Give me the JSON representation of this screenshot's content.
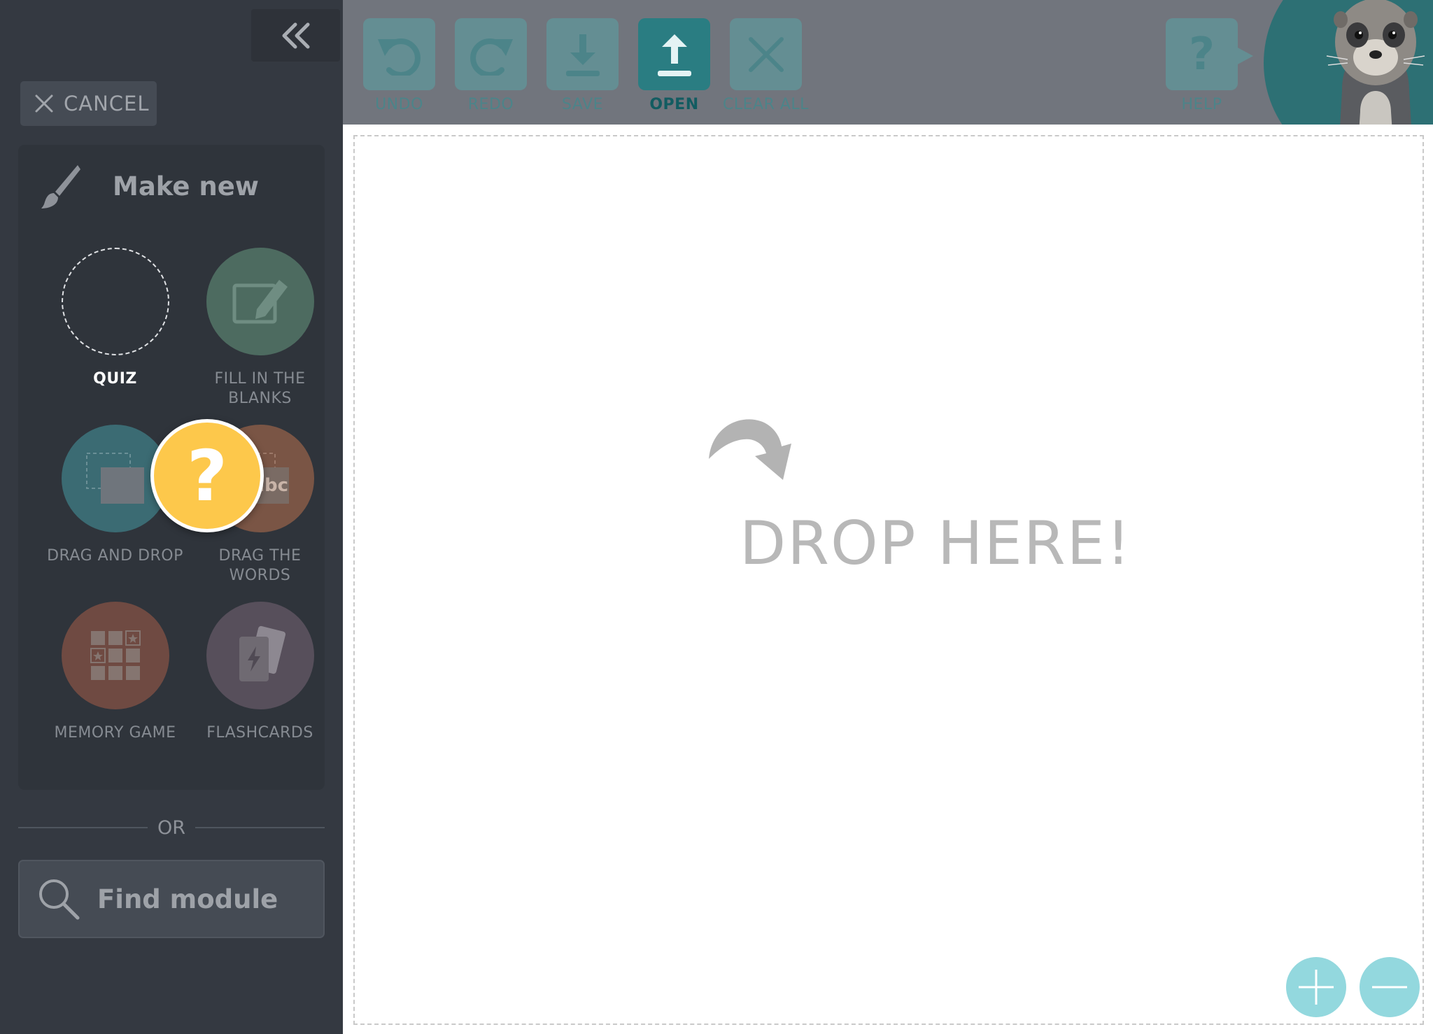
{
  "sidebar": {
    "cancel_label": "CANCEL",
    "make_new_title": "Make new",
    "modules": [
      {
        "label": "QUIZ"
      },
      {
        "label": "FILL IN THE BLANKS"
      },
      {
        "label": "DRAG AND DROP"
      },
      {
        "label": "DRAG THE WORDS",
        "icon_text": "abc"
      },
      {
        "label": "MEMORY GAME"
      },
      {
        "label": "FLASHCARDS"
      }
    ],
    "dragging_glyph": "?",
    "or_label": "OR",
    "find_module_label": "Find module"
  },
  "toolbar": {
    "undo": "UNDO",
    "redo": "REDO",
    "save": "SAVE",
    "open": "OPEN",
    "clear_all": "CLEAR ALL",
    "help": "HELP"
  },
  "canvas": {
    "drop_text": "DROP HERE!"
  },
  "colors": {
    "sidebar_bg": "#343941",
    "toolbar_bg": "#71757d",
    "teal_accent": "#2a7d82",
    "quiz_yellow": "#fdc84b",
    "zoom_button": "#93d8de"
  }
}
